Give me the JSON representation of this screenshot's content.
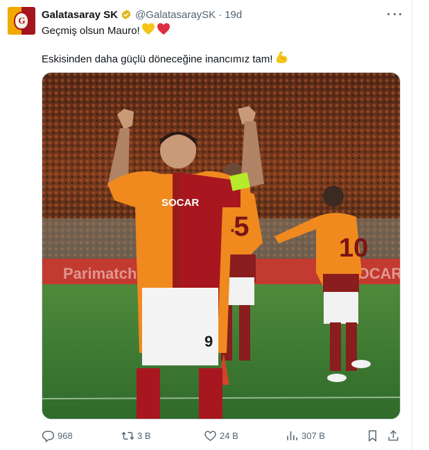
{
  "tweet": {
    "author_name": "Galatasaray SK",
    "handle": "@GalatasaraySK",
    "separator": "·",
    "time": "19d",
    "line1": "Geçmiş olsun Mauro!",
    "line1_emoji": "💛❤️",
    "line2": "Eskisinden daha güçlü döneceğine inancımız tam!",
    "line2_emoji": "💪"
  },
  "media": {
    "sponsor_text": "SOCAR",
    "player_number_front": "9",
    "teammate1_number": "45",
    "teammate2_number": "10",
    "board_text_left": "Parimatch",
    "board_text_right": "SOCAR"
  },
  "actions": {
    "replies": "968",
    "reposts": "3 B",
    "likes": "24 B",
    "views": "307 B"
  },
  "colors": {
    "brand_red": "#a5151d",
    "brand_yellow": "#f2a900",
    "verified_gold": "#e2b719",
    "secondary_text": "#536471"
  },
  "icons": [
    "more-icon",
    "verified-icon",
    "reply-icon",
    "repost-icon",
    "like-icon",
    "views-icon",
    "bookmark-icon",
    "share-icon"
  ]
}
